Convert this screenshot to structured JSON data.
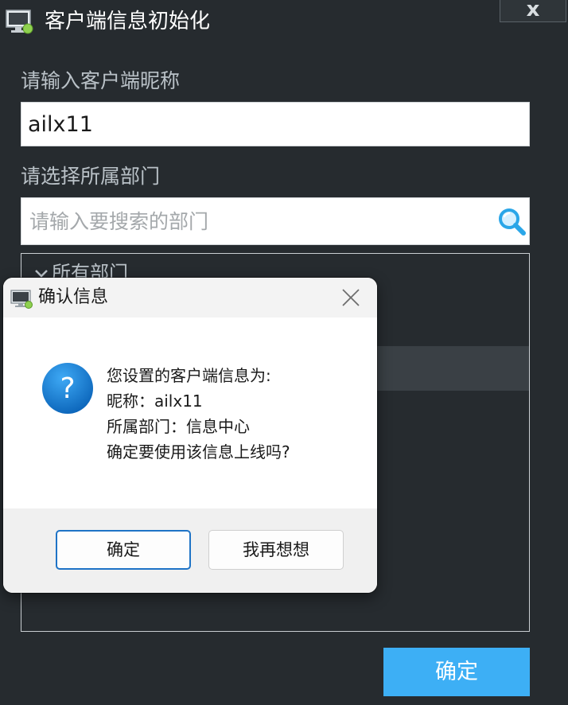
{
  "window": {
    "title": "客户端信息初始化",
    "close_label": "x"
  },
  "form": {
    "nickname_label": "请输入客户端昵称",
    "nickname_value": "ailx11",
    "department_label": "请选择所属部门",
    "search_placeholder": "请输入要搜索的部门",
    "tree_root_label": "所有部门",
    "confirm_label": "确定"
  },
  "dialog": {
    "title": "确认信息",
    "lines": [
      "您设置的客户端信息为:",
      "昵称：ailx11",
      "所属部门：信息中心",
      "确定要使用该信息上线吗?"
    ],
    "ok_label": "确定",
    "cancel_label": "我再想想"
  },
  "colors": {
    "background": "#262b2f",
    "accent": "#3daff5",
    "dialog_primary_border": "#1e73c6"
  }
}
